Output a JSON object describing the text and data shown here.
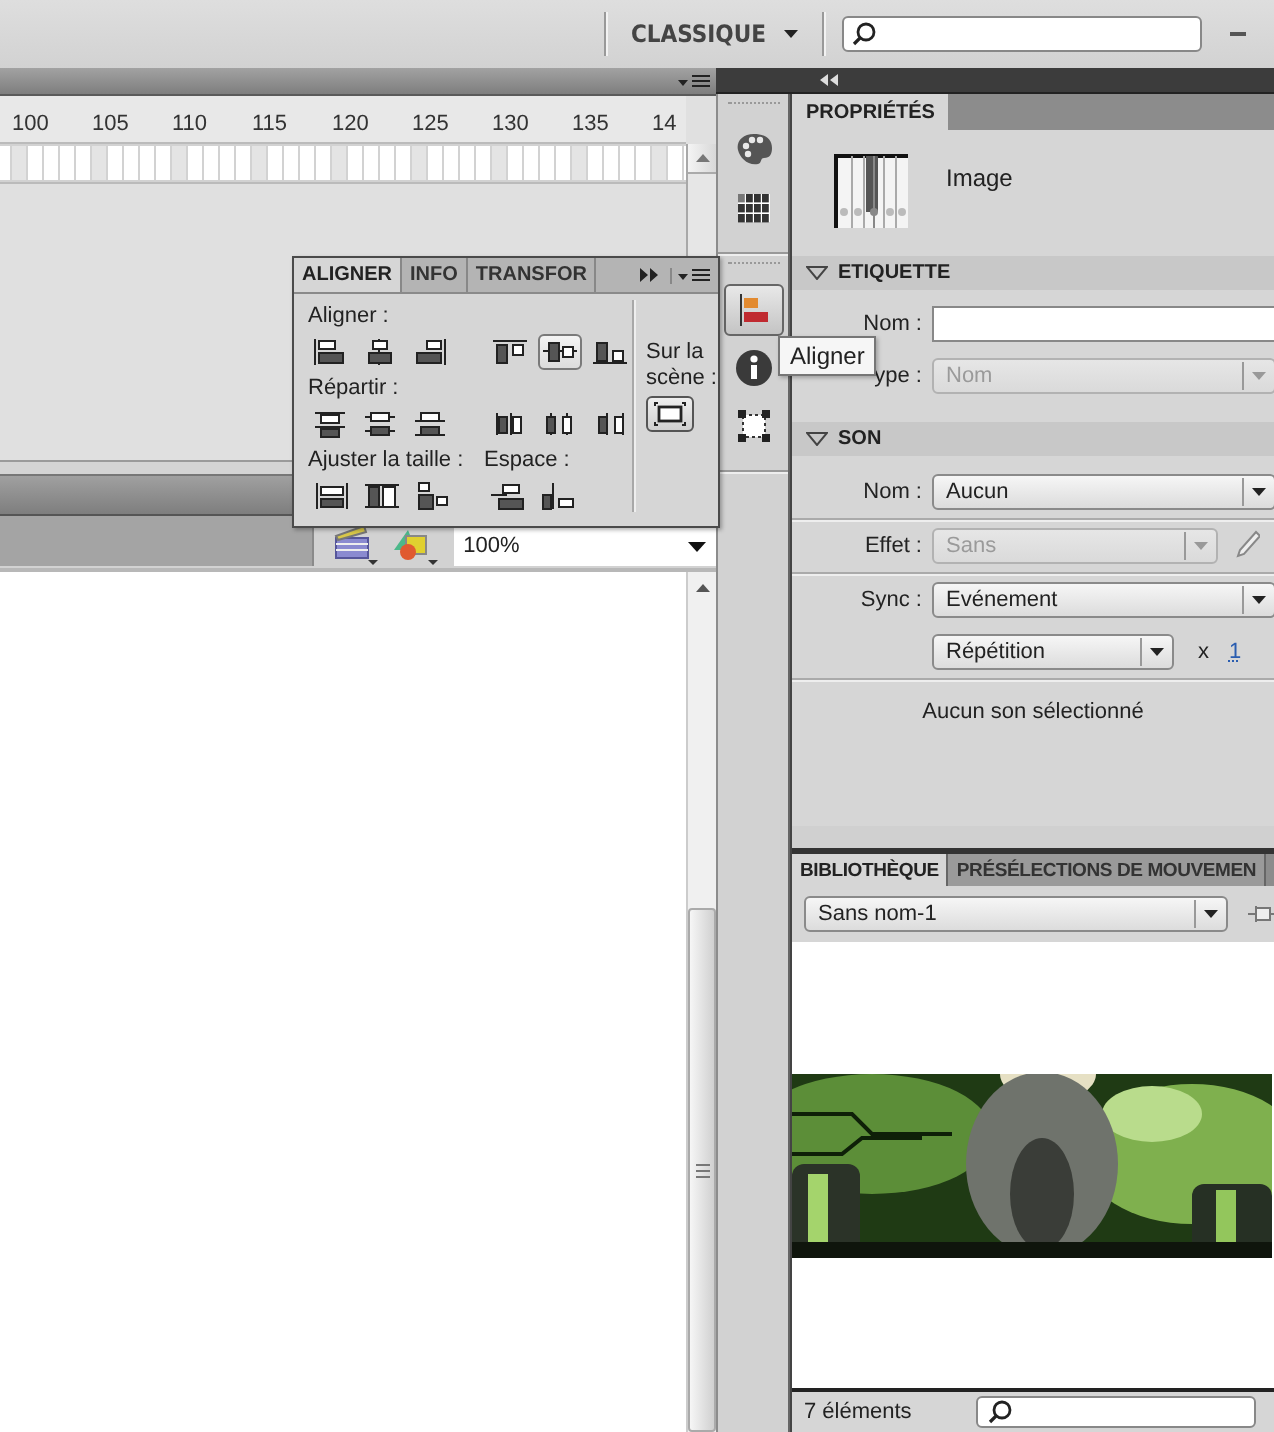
{
  "toolbar": {
    "workspace": "CLASSIQUE"
  },
  "timeline": {
    "frame_numbers": [
      "100",
      "105",
      "110",
      "115",
      "120",
      "125",
      "130",
      "135",
      "14"
    ]
  },
  "edit_bar": {
    "zoom": "100%"
  },
  "align_panel": {
    "tabs": [
      {
        "label": "ALIGNER",
        "selected": true
      },
      {
        "label": "INFO",
        "selected": false
      },
      {
        "label": "TRANSFOR",
        "selected": false
      }
    ],
    "align": {
      "label": "Aligner :",
      "buttons": [
        {
          "kind": "left",
          "selected": false
        },
        {
          "kind": "hcenter",
          "selected": false
        },
        {
          "kind": "right",
          "selected": false
        },
        {
          "kind": "top",
          "selected": false
        },
        {
          "kind": "vcenter",
          "selected": true
        },
        {
          "kind": "bottom",
          "selected": false
        }
      ]
    },
    "distribute": {
      "label": "Répartir :",
      "buttons": [
        {
          "kind": "dist-top",
          "selected": false
        },
        {
          "kind": "dist-vcenter",
          "selected": false
        },
        {
          "kind": "dist-bottom",
          "selected": false
        },
        {
          "kind": "dist-left",
          "selected": false
        },
        {
          "kind": "dist-hcenter",
          "selected": false
        },
        {
          "kind": "dist-right",
          "selected": false
        }
      ]
    },
    "match_size": {
      "label": "Ajuster la taille :",
      "buttons": [
        {
          "kind": "match-width",
          "selected": false
        },
        {
          "kind": "match-height",
          "selected": false
        },
        {
          "kind": "match-both",
          "selected": false
        }
      ]
    },
    "space": {
      "label": "Espace :",
      "buttons": [
        {
          "kind": "space-v",
          "selected": false
        },
        {
          "kind": "space-h",
          "selected": false
        }
      ]
    },
    "stage": {
      "label": "Sur la scène :",
      "selected": true
    }
  },
  "dock": {
    "groups": [
      {
        "items": [
          {
            "kind": "palette",
            "selected": false
          },
          {
            "kind": "swatches",
            "selected": false
          }
        ]
      },
      {
        "items": [
          {
            "kind": "align",
            "selected": true
          },
          {
            "kind": "info",
            "selected": false
          },
          {
            "kind": "transform",
            "selected": false
          }
        ]
      }
    ]
  },
  "tooltip": {
    "text": "Aligner"
  },
  "properties": {
    "tab": {
      "label": "PROPRIÉTÉS",
      "selected": true
    },
    "object_type": "Image",
    "sections": [
      {
        "title": "ETIQUETTE",
        "expanded": true,
        "rows": [
          {
            "kind": "input",
            "label": "Nom :"
          },
          {
            "kind": "select",
            "label": "ype :",
            "value": "Nom",
            "disabled": true
          }
        ]
      },
      {
        "title": "SON",
        "expanded": true,
        "rows": [
          {
            "kind": "select",
            "label": "Nom :",
            "value": "Aucun",
            "disabled": false
          },
          {
            "kind": "select-edit",
            "label": "Effet :",
            "value": "Sans",
            "disabled": true
          },
          {
            "kind": "select",
            "label": "Sync :",
            "value": "Evénement",
            "disabled": false
          },
          {
            "kind": "repeat",
            "value": "Répétition",
            "times": "x",
            "count": "1"
          },
          {
            "kind": "note",
            "text": "Aucun son sélectionné"
          }
        ]
      }
    ]
  },
  "library": {
    "tabs": [
      {
        "label": "BIBLIOTHÈQUE",
        "selected": true
      },
      {
        "label": "PRÉSÉLECTIONS DE MOUVEMEN",
        "selected": false
      }
    ],
    "document": "Sans nom-1",
    "item_count": "7 éléments"
  }
}
